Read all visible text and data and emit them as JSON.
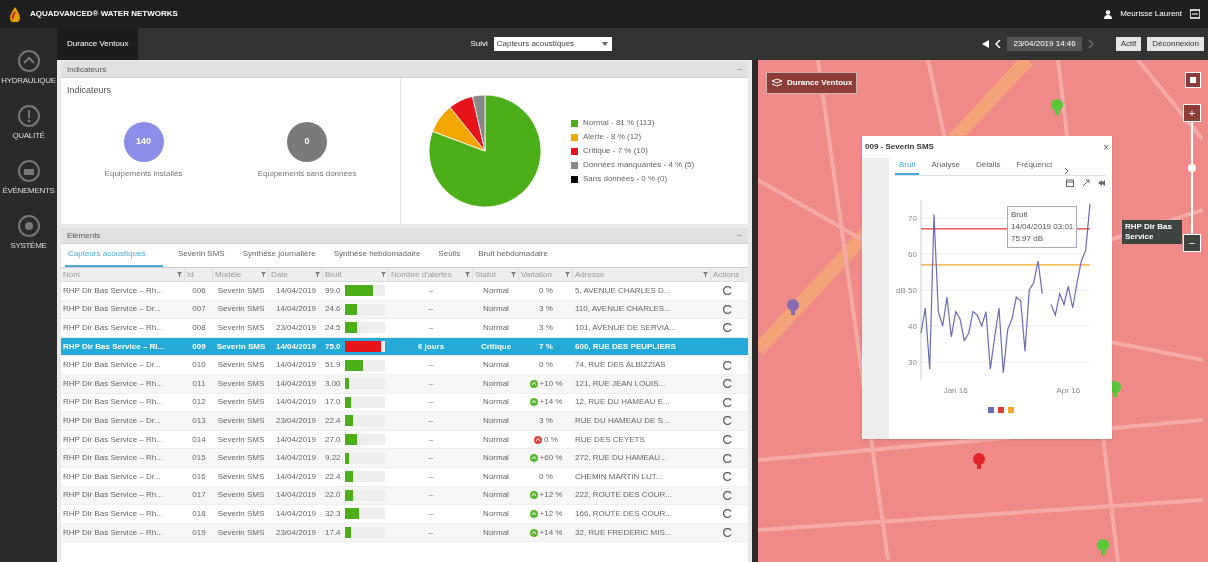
{
  "app": {
    "title": "AQUADVANCED® WATER NETWORKS",
    "user": "Meurisse Laurent"
  },
  "sidebar": {
    "items": [
      {
        "label": "HYDRAULIQUE",
        "selected": false
      },
      {
        "label": "QUALITÉ",
        "selected": false
      },
      {
        "label": "ÉVÉNEMENTS",
        "selected": false
      },
      {
        "label": "SYSTÈME",
        "selected": false
      }
    ]
  },
  "toolbar": {
    "tab": "Durance Ventoux",
    "suivi_label": "Suivi",
    "suivi_value": "Capteurs acoustiques",
    "date": "23/04/2019 14:46",
    "buttons": [
      "Actif",
      "Déconnexion"
    ]
  },
  "indicators": {
    "header": "Indicateurs",
    "collapse": "–",
    "title": "Indicateurs",
    "counters": [
      {
        "value": "140",
        "label": "Equipements installés",
        "color": "#8b8ee8"
      },
      {
        "value": "0",
        "label": "Equipements sans données",
        "color": "#7a7a7a"
      }
    ],
    "chart_data": {
      "type": "pie",
      "categories": [
        "Normal - 81 % (113)",
        "Alerte - 8 % (12)",
        "Critique - 7 % (10)",
        "Données manquantes - 4 % (5)",
        "Sans données - 0 % (0)"
      ],
      "values": [
        113,
        12,
        10,
        5,
        0
      ],
      "colors": [
        "#4caf1a",
        "#f5a500",
        "#e8141c",
        "#888888",
        "#000000"
      ]
    }
  },
  "elements": {
    "header": "Eléments",
    "collapse": "–",
    "tabs": [
      {
        "label": "Capteurs acoustiques",
        "selected": true
      },
      {
        "label": "Severin SMS",
        "selected": false
      },
      {
        "label": "Synthèse journalière",
        "selected": false
      },
      {
        "label": "Synthèse hebdomadaire",
        "selected": false
      },
      {
        "label": "Seuils",
        "selected": false
      },
      {
        "label": "Bruit hebdomadaire",
        "selected": false
      }
    ],
    "columns": [
      "Nom",
      "Id",
      "Modèle",
      "Date",
      "Bruit",
      "Nombre d'alertes",
      "Statut",
      "Variation",
      "Adresse",
      "Actions"
    ],
    "rows": [
      {
        "name": "RHP Dir Bas Service – Rh...",
        "id": "006",
        "model": "Severin SMS",
        "date": "14/04/2019",
        "noise": "99.0",
        "level": 0.7,
        "color": "#4caf1a",
        "alerts": "–",
        "status": "Normal",
        "variation": {
          "text": "0 %"
        },
        "address": "5, AVENUE CHARLES D...",
        "selected": false
      },
      {
        "name": "RHP Dir Bas Service – Dr...",
        "id": "007",
        "model": "Severin SMS",
        "date": "14/04/2019",
        "noise": "24.6",
        "level": 0.3,
        "color": "#4caf1a",
        "alerts": "–",
        "status": "Normal",
        "variation": {
          "text": "3 %"
        },
        "address": "110, AVENUE CHARLES...",
        "selected": false
      },
      {
        "name": "RHP Dir Bas Service – Rh...",
        "id": "008",
        "model": "Severin SMS",
        "date": "23/04/2019",
        "noise": "24.5",
        "level": 0.3,
        "color": "#4caf1a",
        "alerts": "–",
        "status": "Normal",
        "variation": {
          "text": "3 %"
        },
        "address": "101, AVENUE DE SERVIA...",
        "selected": false
      },
      {
        "name": "RHP Dir Bas Service – Ri...",
        "id": "009",
        "model": "Severin SMS",
        "date": "14/04/2019",
        "noise": "75.0",
        "level": 0.9,
        "color": "#e8141c",
        "alerts": "6 jours",
        "status": "Critique",
        "variation": {
          "text": "7 %"
        },
        "address": "600, RUE DES PEUPLIERS",
        "selected": true
      },
      {
        "name": "RHP Dir Bas Service – Dr...",
        "id": "010",
        "model": "Severin SMS",
        "date": "14/04/2019",
        "noise": "51.9",
        "level": 0.45,
        "color": "#4caf1a",
        "alerts": "–",
        "status": "Normal",
        "variation": {
          "text": "0 %"
        },
        "address": "74, RUE DES ALBIZZIAS",
        "selected": false
      },
      {
        "name": "RHP Dir Bas Service – Rh...",
        "id": "011",
        "model": "Severin SMS",
        "date": "14/04/2019",
        "noise": "3.00",
        "level": 0,
        "color": "#4caf1a",
        "alerts": "–",
        "status": "Normal",
        "variation": {
          "text": "+10 %",
          "color": "#5cb82a"
        },
        "address": "121, RUE JEAN LOUIS...",
        "selected": false
      },
      {
        "name": "RHP Dir Bas Service – Rh...",
        "id": "012",
        "model": "Severin SMS",
        "date": "14/04/2019",
        "noise": "17.0",
        "level": 0.15,
        "color": "#4caf1a",
        "alerts": "–",
        "status": "Normal",
        "variation": {
          "text": "+14 %",
          "color": "#5cb82a"
        },
        "address": "12, RUE DU HAMEAU E...",
        "selected": false
      },
      {
        "name": "RHP Dir Bas Service – Dr...",
        "id": "013",
        "model": "Severin SMS",
        "date": "23/04/2019",
        "noise": "22.4",
        "level": 0.2,
        "color": "#4caf1a",
        "alerts": "–",
        "status": "Normal",
        "variation": {
          "text": "3 %"
        },
        "address": "RUE DU HAMEAU DE S...",
        "selected": false
      },
      {
        "name": "RHP Dir Bas Service – Rh...",
        "id": "014",
        "model": "Severin SMS",
        "date": "14/04/2019",
        "noise": "27.0",
        "level": 0.3,
        "color": "#4caf1a",
        "alerts": "–",
        "status": "Normal",
        "variation": {
          "text": "0 %",
          "color": "#e0463c"
        },
        "address": "RUE DES CEYETS",
        "selected": false
      },
      {
        "name": "RHP Dir Bas Service – Rh...",
        "id": "015",
        "model": "Severin SMS",
        "date": "14/04/2019",
        "noise": "9.22",
        "level": 0.05,
        "color": "#4caf1a",
        "alerts": "–",
        "status": "Normal",
        "variation": {
          "text": "+60 %",
          "color": "#5cb82a"
        },
        "address": "272, RUE DU HAMEAU...",
        "selected": false
      },
      {
        "name": "RHP Dir Bas Service – Dr...",
        "id": "016",
        "model": "Severin SMS",
        "date": "14/04/2019",
        "noise": "22.4",
        "level": 0.2,
        "color": "#4caf1a",
        "alerts": "–",
        "status": "Normal",
        "variation": {
          "text": "0 %"
        },
        "address": "CHEMIN MARTIN LUT...",
        "selected": false
      },
      {
        "name": "RHP Dir Bas Service – Rh...",
        "id": "017",
        "model": "Severin SMS",
        "date": "14/04/2019",
        "noise": "22.0",
        "level": 0.2,
        "color": "#4caf1a",
        "alerts": "–",
        "status": "Normal",
        "variation": {
          "text": "+12 %",
          "color": "#5cb82a"
        },
        "address": "222, ROUTE DES COUR...",
        "selected": false
      },
      {
        "name": "RHP Dir Bas Service – Rh...",
        "id": "018",
        "model": "Severin SMS",
        "date": "14/04/2019",
        "noise": "32.3",
        "level": 0.35,
        "color": "#4caf1a",
        "alerts": "–",
        "status": "Normal",
        "variation": {
          "text": "+12 %",
          "color": "#5cb82a"
        },
        "address": "166, ROUTE DES COUR...",
        "selected": false
      },
      {
        "name": "RHP Dir Bas Service – Rh...",
        "id": "019",
        "model": "Severin SMS",
        "date": "23/04/2019",
        "noise": "17.4",
        "level": 0.15,
        "color": "#4caf1a",
        "alerts": "–",
        "status": "Normal",
        "variation": {
          "text": "+14 %",
          "color": "#5cb82a"
        },
        "address": "32, RUE FREDERIC MIS...",
        "selected": false
      }
    ]
  },
  "map": {
    "label": "Durance Ventoux",
    "side_label": "RHP Dir Bas Service",
    "zoom_in": "+",
    "zoom_out": "−",
    "popup": {
      "title": "009 - Severin SMS",
      "close": "×",
      "tabs": [
        {
          "label": "Bruit",
          "selected": true
        },
        {
          "label": "Analyse",
          "selected": false
        },
        {
          "label": "Détails",
          "selected": false
        },
        {
          "label": "Fréquenci",
          "selected": false
        }
      ],
      "tooltip": [
        "14/04/2019 03:01",
        "75.97 dB"
      ],
      "chart_data": {
        "type": "line",
        "ylabel": "dB",
        "categories": [
          null,
          null,
          null,
          null,
          null,
          null,
          null,
          null,
          "Jan 16",
          null,
          null,
          null,
          null,
          null,
          null,
          null,
          null,
          null,
          null,
          null,
          null,
          null,
          null,
          null,
          null,
          null,
          null,
          null,
          null,
          null,
          null,
          null,
          null,
          null,
          "Apr 16",
          null,
          null,
          null,
          null,
          null
        ],
        "yticks": [
          30,
          40,
          50,
          60,
          70
        ],
        "ylim": [
          25,
          75
        ],
        "grid": true,
        "series": [
          {
            "name": "Bruit",
            "color": "#6a6bb8",
            "values": [
              38,
              45,
              28,
              71,
              44,
              40,
              48,
              37,
              44,
              42,
              36,
              38,
              44,
              43,
              40,
              44,
              28,
              37,
              45,
              27,
              39,
              42,
              48,
              47,
              33,
              50,
              52,
              58,
              49,
              null,
              46,
              43,
              49,
              46,
              51,
              45,
              52,
              58,
              61,
              74
            ]
          }
        ],
        "ref_lines": [
          {
            "axis": "y",
            "value": 67,
            "color": "#e53935"
          },
          {
            "axis": "y",
            "value": 57,
            "color": "#f5a623"
          }
        ]
      }
    }
  }
}
